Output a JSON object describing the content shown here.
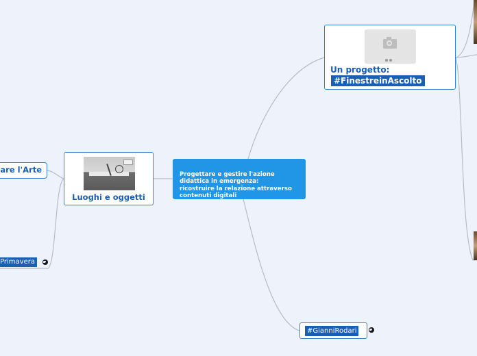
{
  "central": {
    "text": "Progettare e gestire l'azione\ndidattica in emergenza:\nricostruire la relazione attraverso\ncontenuti digitali"
  },
  "luoghi": {
    "label": "Luoghi e oggetti"
  },
  "progetto": {
    "line1": "Un progetto:",
    "line2": "#FinestreinAscolto"
  },
  "arte": {
    "label": "are l'Arte"
  },
  "primavera": {
    "label": "Primavera"
  },
  "gianni": {
    "label": "#GianniRodari"
  },
  "icons": {
    "camera": "camera-icon",
    "link": "globe-link-icon"
  },
  "colors": {
    "central_fill": "#2196e6",
    "node_border": "#2f7fd3",
    "label_fill": "#1a5fb4",
    "background": "#eef3fb"
  }
}
